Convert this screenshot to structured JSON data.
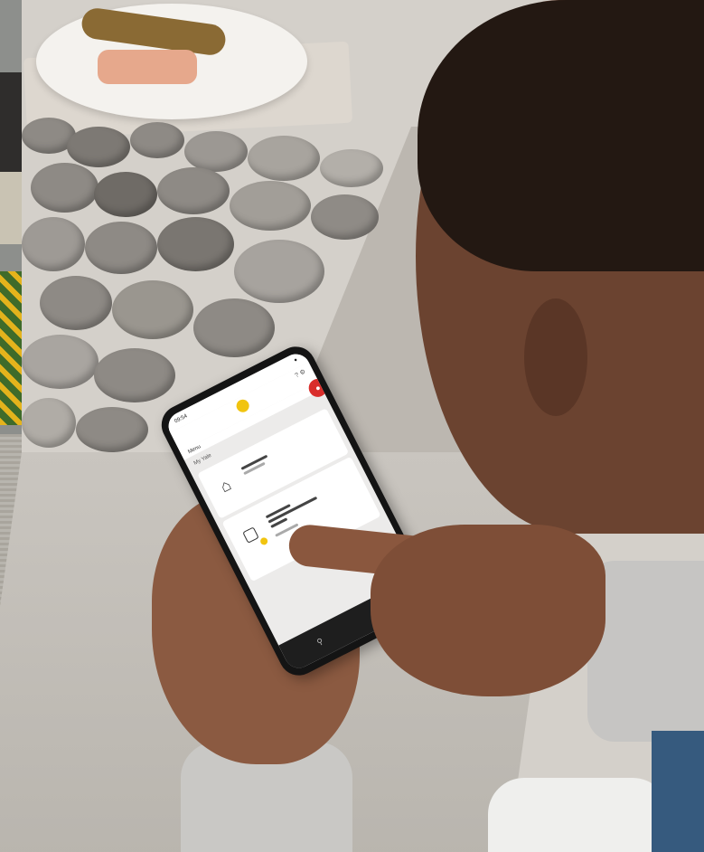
{
  "scene": {
    "description_colors": {
      "accent_blue": "#365a7e",
      "app_red": "#d92d2b",
      "app_yellow": "#f1c40f"
    }
  },
  "phone": {
    "status_time": "09:54",
    "status_indicator": "●",
    "header_icons": "? ⚙",
    "menu_label": "Menu",
    "section_title": "My Yale",
    "card1_icon": "⌂",
    "card2_icon": "▢",
    "nav_icon_1": "⚲",
    "nav_icon_2": "✓",
    "gesture_back": "◀",
    "gesture_home": "●",
    "gesture_recent": "■"
  }
}
